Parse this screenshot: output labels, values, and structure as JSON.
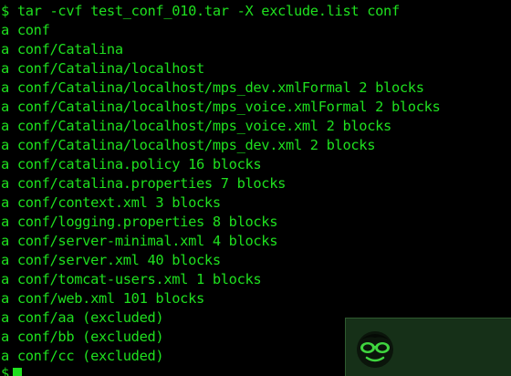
{
  "terminal": {
    "lines": [
      "$ tar -cvf test_conf_010.tar -X exclude.list conf",
      "a conf",
      "a conf/Catalina",
      "a conf/Catalina/localhost",
      "a conf/Catalina/localhost/mps_dev.xmlFormal 2 blocks",
      "a conf/Catalina/localhost/mps_voice.xmlFormal 2 blocks",
      "a conf/Catalina/localhost/mps_voice.xml 2 blocks",
      "a conf/Catalina/localhost/mps_dev.xml 2 blocks",
      "a conf/catalina.policy 16 blocks",
      "a conf/catalina.properties 7 blocks",
      "a conf/context.xml 3 blocks",
      "a conf/logging.properties 8 blocks",
      "a conf/server-minimal.xml 4 blocks",
      "a conf/server.xml 40 blocks",
      "a conf/tomcat-users.xml 1 blocks",
      "a conf/web.xml 101 blocks",
      "a conf/aa (excluded)",
      "a conf/bb (excluded)",
      "a conf/cc (excluded)"
    ],
    "prompt": "$",
    "colors": {
      "background": "#000000",
      "text": "#1fe01f",
      "widget_background": "#163018"
    }
  },
  "widget": {
    "icon": "sunglasses-face-icon"
  }
}
